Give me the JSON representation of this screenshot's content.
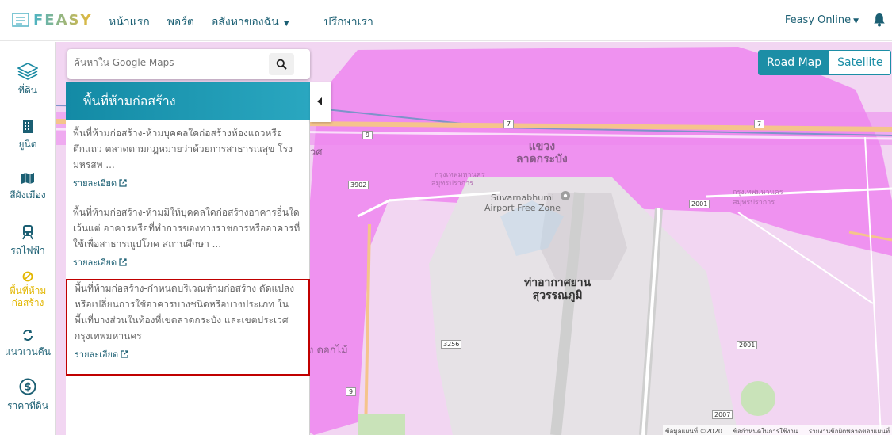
{
  "brand": {
    "logo_text": "FEASY"
  },
  "nav": {
    "links": [
      "หน้าแรก",
      "พอร์ต",
      "อสังหาของฉัน",
      "ปรึกษาเรา"
    ],
    "user_menu": "Feasy Online"
  },
  "sidebar": {
    "items": [
      {
        "label": "ที่ดิน",
        "icon": "layers-icon"
      },
      {
        "label": "ยูนิต",
        "icon": "building-icon"
      },
      {
        "label": "สีผังเมือง",
        "icon": "map-icon"
      },
      {
        "label": "รถไฟฟ้า",
        "icon": "train-icon"
      },
      {
        "label": "พื้นที่ห้ามก่อสร้าง",
        "icon": "ban-icon",
        "active": true
      },
      {
        "label": "แนวเวนคืน",
        "icon": "refresh-icon"
      },
      {
        "label": "ราคาที่ดิน",
        "icon": "dollar-icon"
      }
    ]
  },
  "search": {
    "placeholder": "ค้นหาใน Google Maps"
  },
  "panel": {
    "title": "พื้นที่ห้ามก่อสร้าง",
    "items": [
      {
        "text": "พื้นที่ห้ามก่อสร้าง-ห้ามบุคคลใดก่อสร้างห้องแถวหรือตึกแถว ตลาดตามกฎหมายว่าด้วยการสาธารณสุข โรงมหรสพ ...",
        "detail": "รายละเอียด"
      },
      {
        "text": "พื้นที่ห้ามก่อสร้าง-ห้ามมิให้บุคคลใดก่อสร้างอาคารอื่นใด เว้นแต่ อาคารหรือที่ทำการของทางราชการหรืออาคารที่ใช้เพื่อสาธารณูปโภค สถานศึกษา ...",
        "detail": "รายละเอียด"
      },
      {
        "text": "พื้นที่ห้ามก่อสร้าง-กำหนดบริเวณห้ามก่อสร้าง ดัดแปลงหรือเปลี่ยนการใช้อาคารบางชนิดหรือบางประเภท ในพื้นที่บางส่วนในท้องที่เขตลาดกระบัง และเขตประเวศ กรุงเทพมหานคร",
        "detail": "รายละเอียด",
        "selected": true
      }
    ]
  },
  "map_type": {
    "road": "Road Map",
    "satellite": "Satellite",
    "selected": "Road Map"
  },
  "map_labels": {
    "district": "แขวง\nลาดกระบัง",
    "district_line1": "แขวง",
    "district_line2": "ลาดกระบัง",
    "bkk1": "กรุงเทพมหานคร",
    "sp1": "สมุทรปราการ",
    "bkk2": "กรุงเทพมหานคร",
    "sp2": "สมุทรปราการ",
    "free_zone_1": "Suvarnabhumi",
    "free_zone_2": "Airport Free Zone",
    "airport_1": "ท่าอากาศยาน",
    "airport_2": "สุวรรณภูมิ",
    "dokmai": "ง ดอกไม้",
    "wet": "วศ",
    "route_3902": "3902",
    "route_3256": "3256",
    "route_2001a": "2001",
    "route_2001b": "2001",
    "route_2007": "2007",
    "route_7a": "7",
    "route_7b": "7",
    "route_9a": "9",
    "route_9b": "9"
  },
  "map_footer": {
    "copyright": "ข้อมูลแผนที่ ©2020",
    "terms": "ข้อกำหนดในการใช้งาน",
    "report": "รายงานข้อผิดพลาดของแผนที่"
  },
  "colors": {
    "accent": "#1c8ea6",
    "brand_teal": "#1b5f73",
    "zone_pink": "#ee8bf0",
    "active_yellow": "#e2b600",
    "selection_red": "#c00000"
  }
}
